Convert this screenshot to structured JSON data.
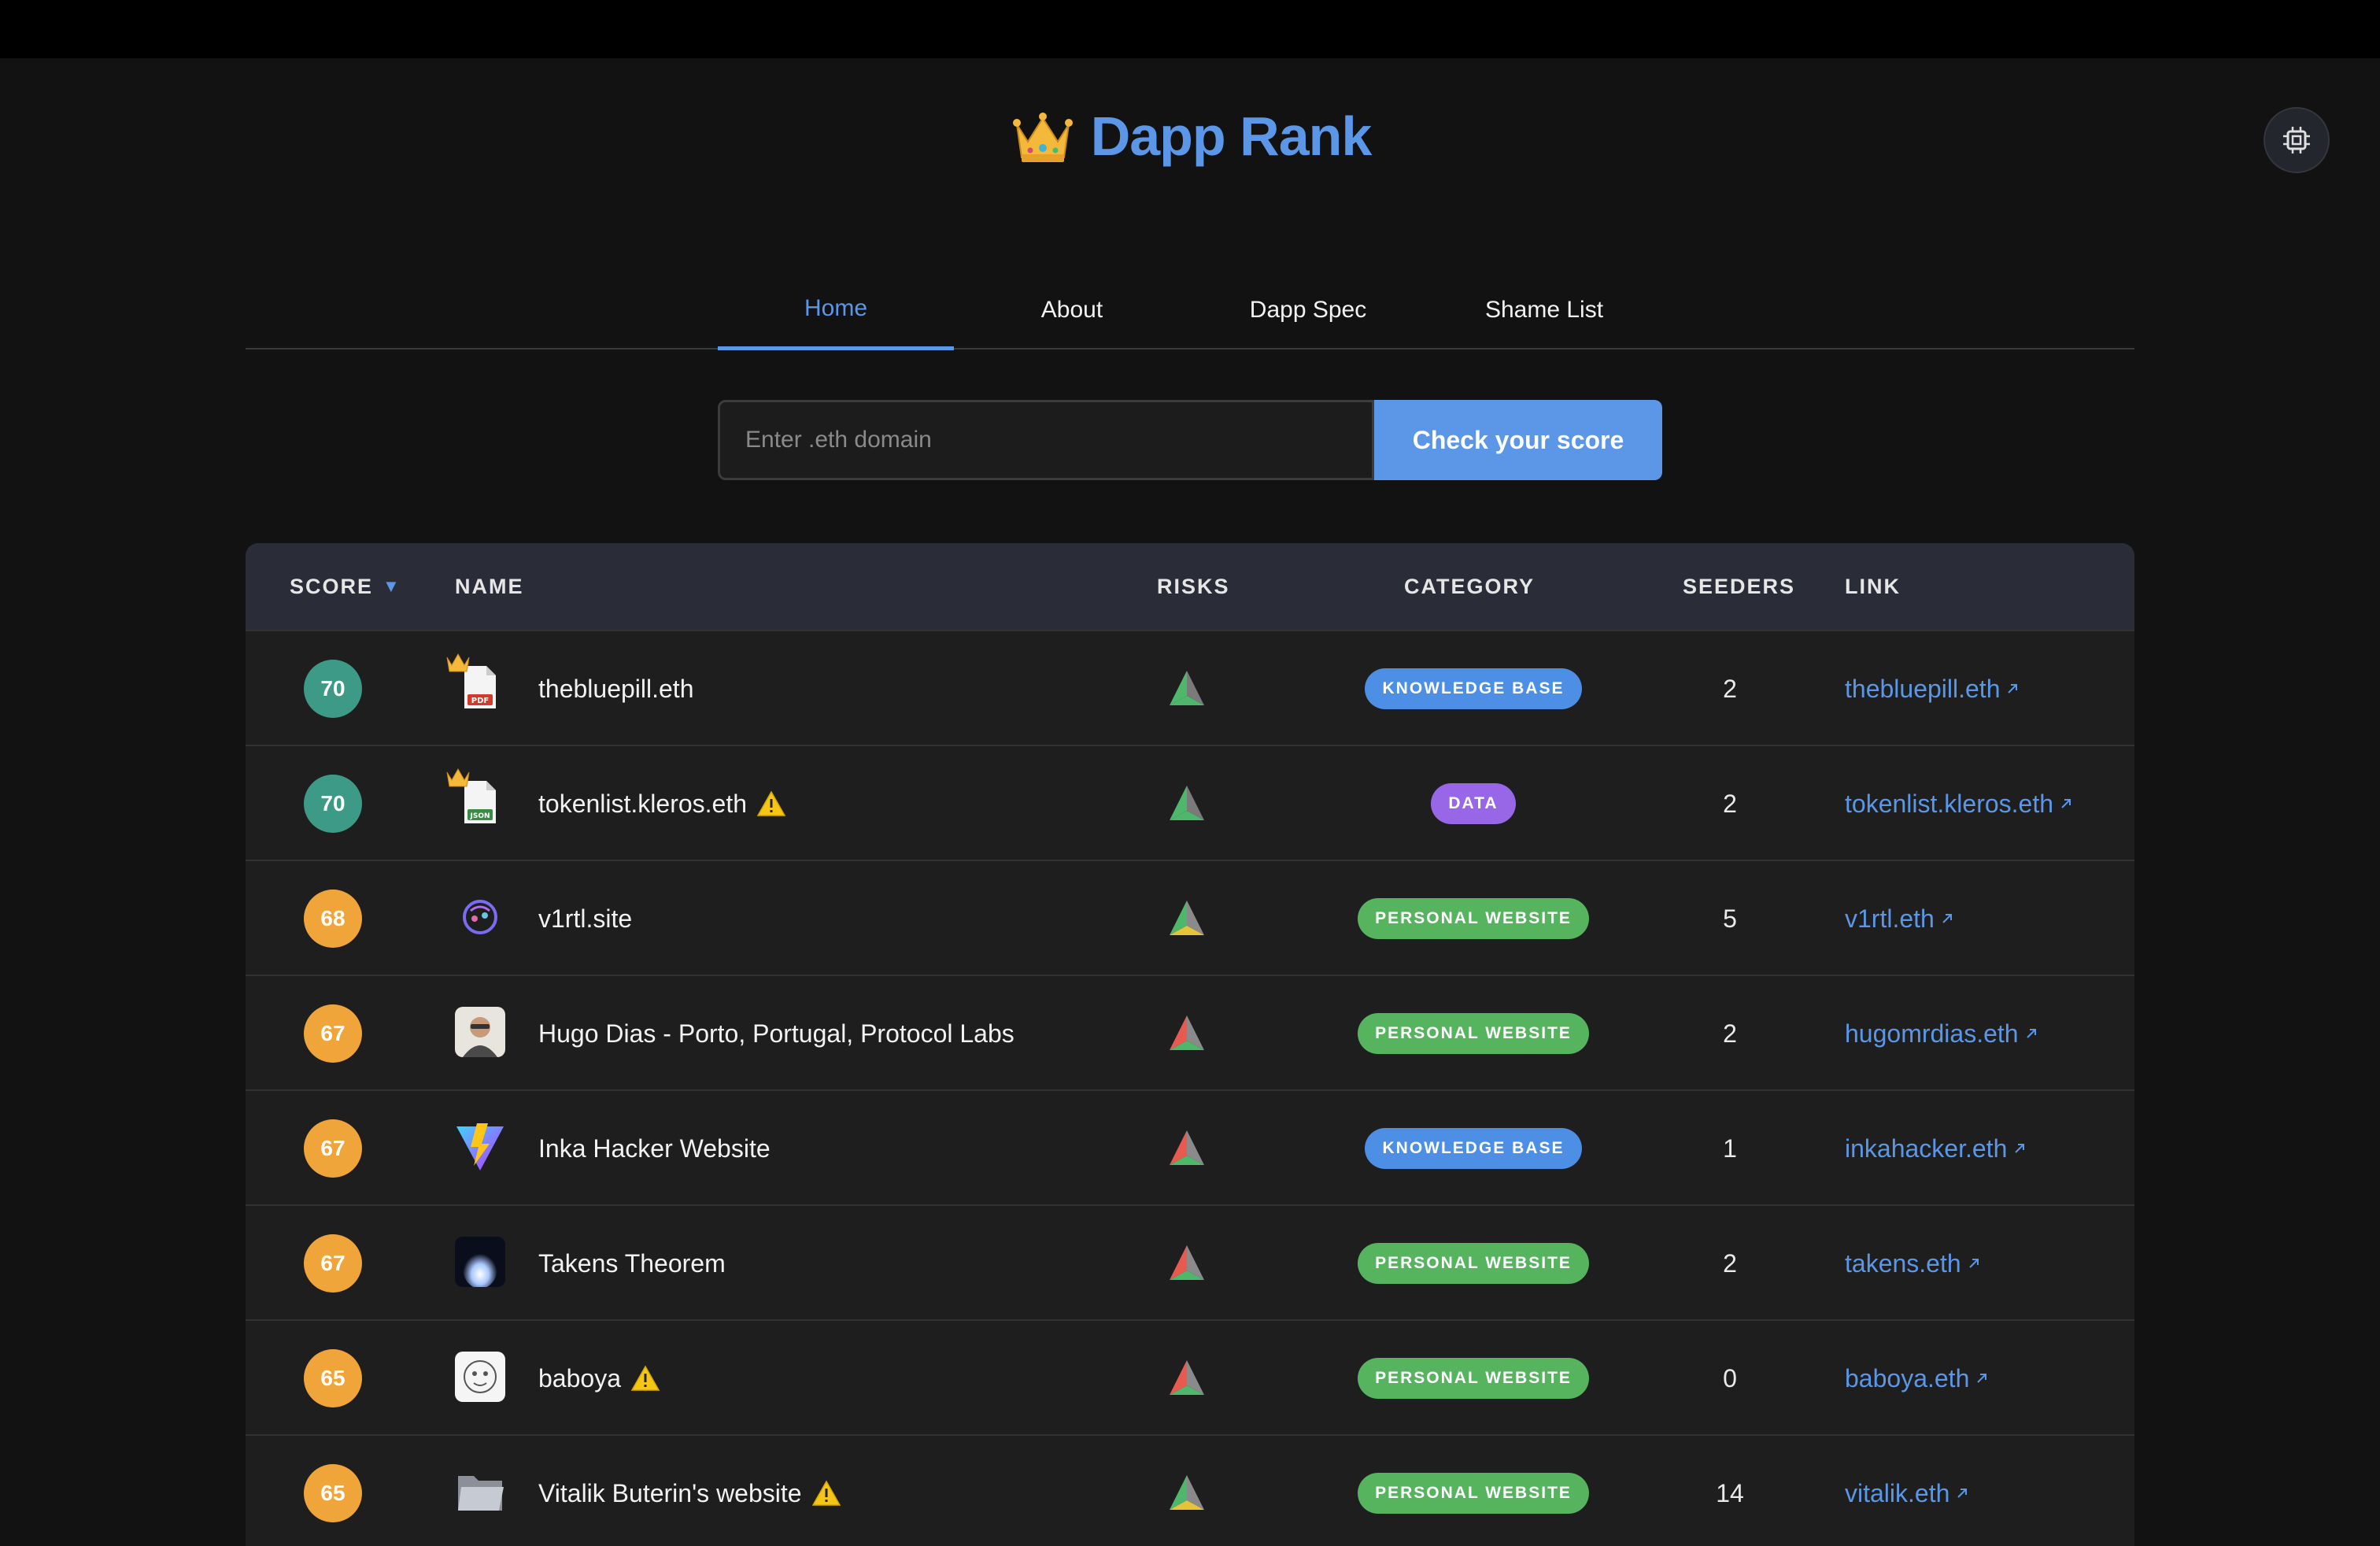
{
  "header": {
    "title": "Dapp Rank",
    "brand_icon": "crown-icon",
    "settings_icon": "chip-icon"
  },
  "tabs": [
    {
      "label": "Home",
      "active": true
    },
    {
      "label": "About",
      "active": false
    },
    {
      "label": "Dapp Spec",
      "active": false
    },
    {
      "label": "Shame List",
      "active": false
    }
  ],
  "search": {
    "placeholder": "Enter .eth domain",
    "value": "",
    "button_label": "Check your score"
  },
  "table": {
    "columns": {
      "score": "SCORE",
      "name": "NAME",
      "risks": "RISKS",
      "category": "CATEGORY",
      "seeders": "SEEDERS",
      "link": "LINK"
    },
    "sort_icon": "caret-down-icon",
    "colors": {
      "score_green": "#3d9a87",
      "score_orange": "#f0a53b",
      "knowledge_base": "#4c8fe4",
      "data": "#9867e8",
      "personal_website": "#56b45f",
      "link": "#5b97e6"
    },
    "rows": [
      {
        "score": "70",
        "name": "thebluepill.eth",
        "warning": false,
        "icon": "pdf-file-icon",
        "crowned": true,
        "category": "KNOWLEDGE BASE",
        "seeders": "2",
        "link": "thebluepill.eth"
      },
      {
        "score": "70",
        "name": "tokenlist.kleros.eth",
        "warning": true,
        "icon": "json-file-icon",
        "crowned": true,
        "category": "DATA",
        "seeders": "2",
        "link": "tokenlist.kleros.eth"
      },
      {
        "score": "68",
        "name": "v1rtl.site",
        "warning": false,
        "icon": "v1rtl-logo-icon",
        "crowned": false,
        "category": "PERSONAL WEBSITE",
        "seeders": "5",
        "link": "v1rtl.eth"
      },
      {
        "score": "67",
        "name": "Hugo Dias - Porto, Portugal, Protocol Labs",
        "warning": false,
        "icon": "portrait-avatar-icon",
        "crowned": false,
        "category": "PERSONAL WEBSITE",
        "seeders": "2",
        "link": "hugomrdias.eth"
      },
      {
        "score": "67",
        "name": "Inka Hacker Website",
        "warning": false,
        "icon": "vite-logo-icon",
        "crowned": false,
        "category": "KNOWLEDGE BASE",
        "seeders": "1",
        "link": "inkahacker.eth"
      },
      {
        "score": "67",
        "name": "Takens Theorem",
        "warning": false,
        "icon": "light-burst-icon",
        "crowned": false,
        "category": "PERSONAL WEBSITE",
        "seeders": "2",
        "link": "takens.eth"
      },
      {
        "score": "65",
        "name": "baboya",
        "warning": true,
        "icon": "sketch-avatar-icon",
        "crowned": false,
        "category": "PERSONAL WEBSITE",
        "seeders": "0",
        "link": "baboya.eth"
      },
      {
        "score": "65",
        "name": "Vitalik Buterin's website",
        "warning": true,
        "icon": "folder-icon",
        "crowned": false,
        "category": "PERSONAL WEBSITE",
        "seeders": "14",
        "link": "vitalik.eth"
      }
    ]
  }
}
